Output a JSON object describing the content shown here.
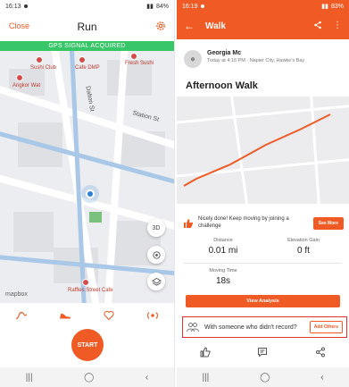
{
  "left": {
    "status": {
      "time": "16:13",
      "battery": "84%"
    },
    "header": {
      "close_label": "Close",
      "title": "Run"
    },
    "gps_banner": "GPS SIGNAL ACQUIRED",
    "map": {
      "streets": [
        "Dalton St",
        "Station St"
      ],
      "places": [
        "Sushi Club",
        "Cafe DMP",
        "Fresh Sushi",
        "Angkor Wat",
        "Raffles Street Cafe"
      ],
      "layer_3d_label": "3D",
      "attribution": "mapbox"
    },
    "start_label": "START"
  },
  "right": {
    "status": {
      "time": "16:19",
      "battery": "83%"
    },
    "header": {
      "title": "Walk"
    },
    "profile": {
      "name": "Georgia Mc",
      "subtitle": "Today at 4:16 PM · Napier City, Hawke's Bay"
    },
    "activity_title": "Afternoon Walk",
    "encourage": {
      "text": "Nicely done! Keep moving by joining a challenge",
      "button": "See More"
    },
    "stats": {
      "distance_label": "Distance",
      "distance_value": "0.01 mi",
      "elevation_label": "Elevation Gain",
      "elevation_value": "0 ft",
      "moving_time_label": "Moving Time",
      "moving_time_value": "18s"
    },
    "view_analysis_label": "View Analysis",
    "record_prompt": {
      "text": "With someone who didn't record?",
      "button": "Add Others"
    }
  },
  "colors": {
    "brand": "#f05a24",
    "gps_green": "#37c768",
    "route": "#f05a24",
    "highlight_border": "#e03131",
    "location": "#2f7ed8"
  },
  "icons": {
    "left": [
      "settings-gear-icon",
      "route-icon",
      "shoe-icon",
      "heart-icon",
      "sensor-icon",
      "compass-icon",
      "layers-icon"
    ],
    "right": [
      "back-arrow-icon",
      "share-icon",
      "more-icon",
      "thumb-up-icon",
      "people-icon",
      "kudos-icon",
      "comment-icon"
    ]
  }
}
